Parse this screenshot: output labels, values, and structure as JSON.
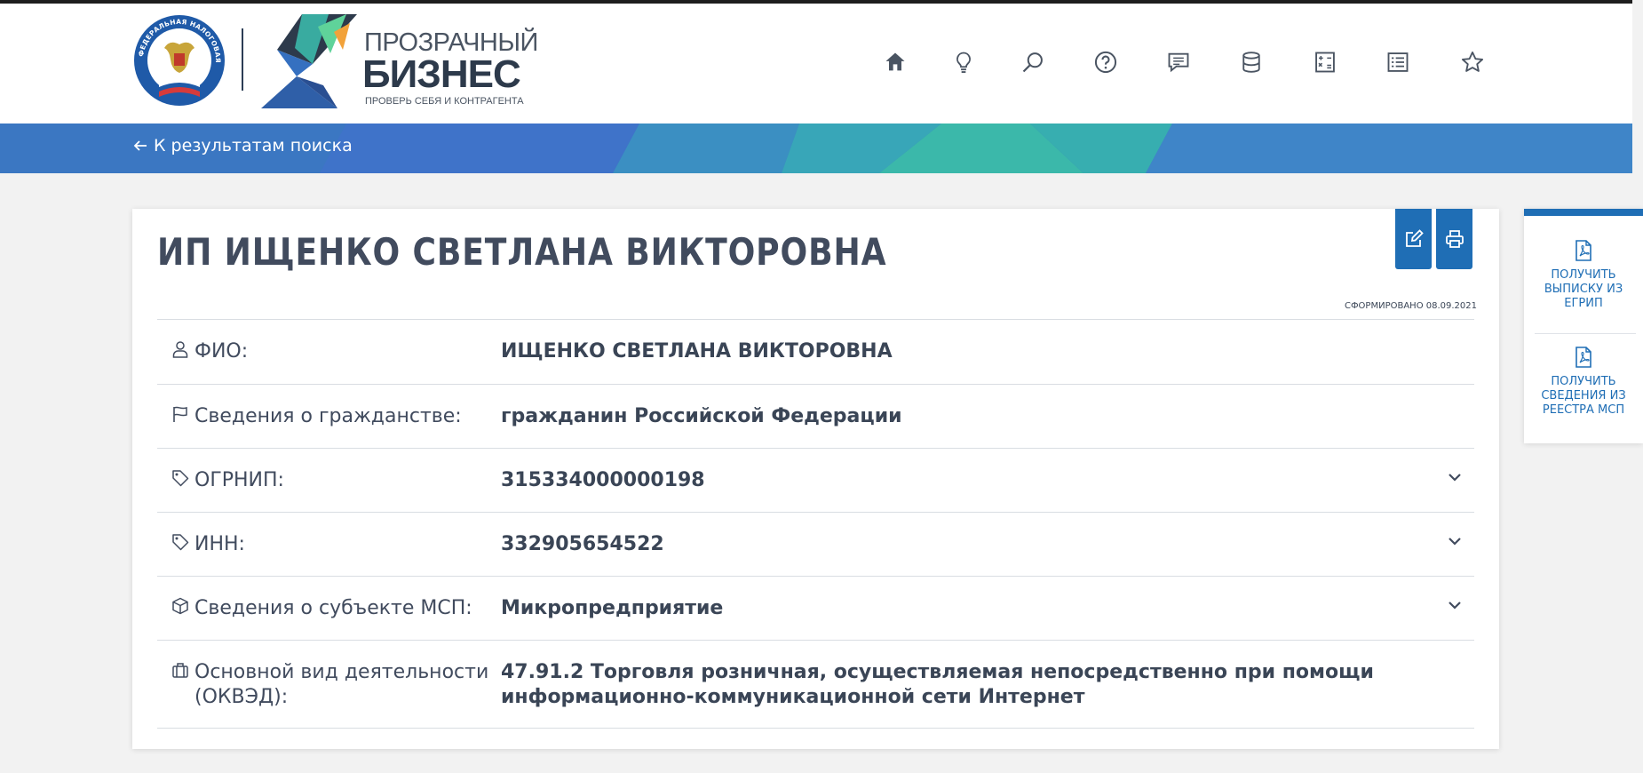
{
  "logo": {
    "fns_ring_text": "ФЕДЕРАЛЬНАЯ НАЛОГОВАЯ СЛУЖБА",
    "title_line1": "ПРОЗРАЧНЫЙ",
    "title_line2": "БИЗНЕС",
    "tagline": "ПРОВЕРЬ СЕБЯ И КОНТРАГЕНТА"
  },
  "nav": {
    "icons": [
      "home-icon",
      "lightbulb-icon",
      "search-icon",
      "help-circle-icon",
      "chat-icon",
      "database-icon",
      "calculator-icon",
      "list-icon",
      "star-icon"
    ]
  },
  "banner": {
    "back_link": "К результатам поиска"
  },
  "card": {
    "title": "ИП ИЩЕНКО СВЕТЛАНА ВИКТОРОВНА",
    "generated": "СФОРМИРОВАНО 08.09.2021",
    "actions": [
      "edit-icon",
      "print-icon"
    ],
    "rows": [
      {
        "icon": "person-icon",
        "label": "ФИО:",
        "value": "ИЩЕНКО СВЕТЛАНА ВИКТОРОВНА",
        "expandable": false
      },
      {
        "icon": "flag-icon",
        "label": "Сведения о гражданстве:",
        "value": "гражданин Российской Федерации",
        "expandable": false
      },
      {
        "icon": "tag-icon",
        "label": "ОГРНИП:",
        "value": "315334000000198",
        "expandable": true
      },
      {
        "icon": "tag-icon",
        "label": "ИНН:",
        "value": "332905654522",
        "expandable": true
      },
      {
        "icon": "cube-icon",
        "label": "Сведения о субъекте МСП:",
        "value": "Микропредприятие",
        "expandable": true
      },
      {
        "icon": "briefcase-icon",
        "label": "Основной вид деятельности (ОКВЭД):",
        "value": "47.91.2 Торговля розничная, осуществляемая непосредственно при помощи информационно-коммуникационной сети Интернет",
        "expandable": false
      }
    ]
  },
  "side_panel": {
    "items": [
      {
        "icon": "pdf-file-icon",
        "label": "ПОЛУЧИТЬ ВЫПИСКУ ИЗ ЕГРИП"
      },
      {
        "icon": "pdf-file-icon",
        "label": "ПОЛУЧИТЬ СВЕДЕНИЯ ИЗ РЕЕСТРА МСП"
      }
    ]
  },
  "colors": {
    "accent": "#1f6eb5",
    "text": "#3a4556",
    "banner_blue": "#3d7fc4",
    "banner_teal": "#3bb8aa"
  }
}
